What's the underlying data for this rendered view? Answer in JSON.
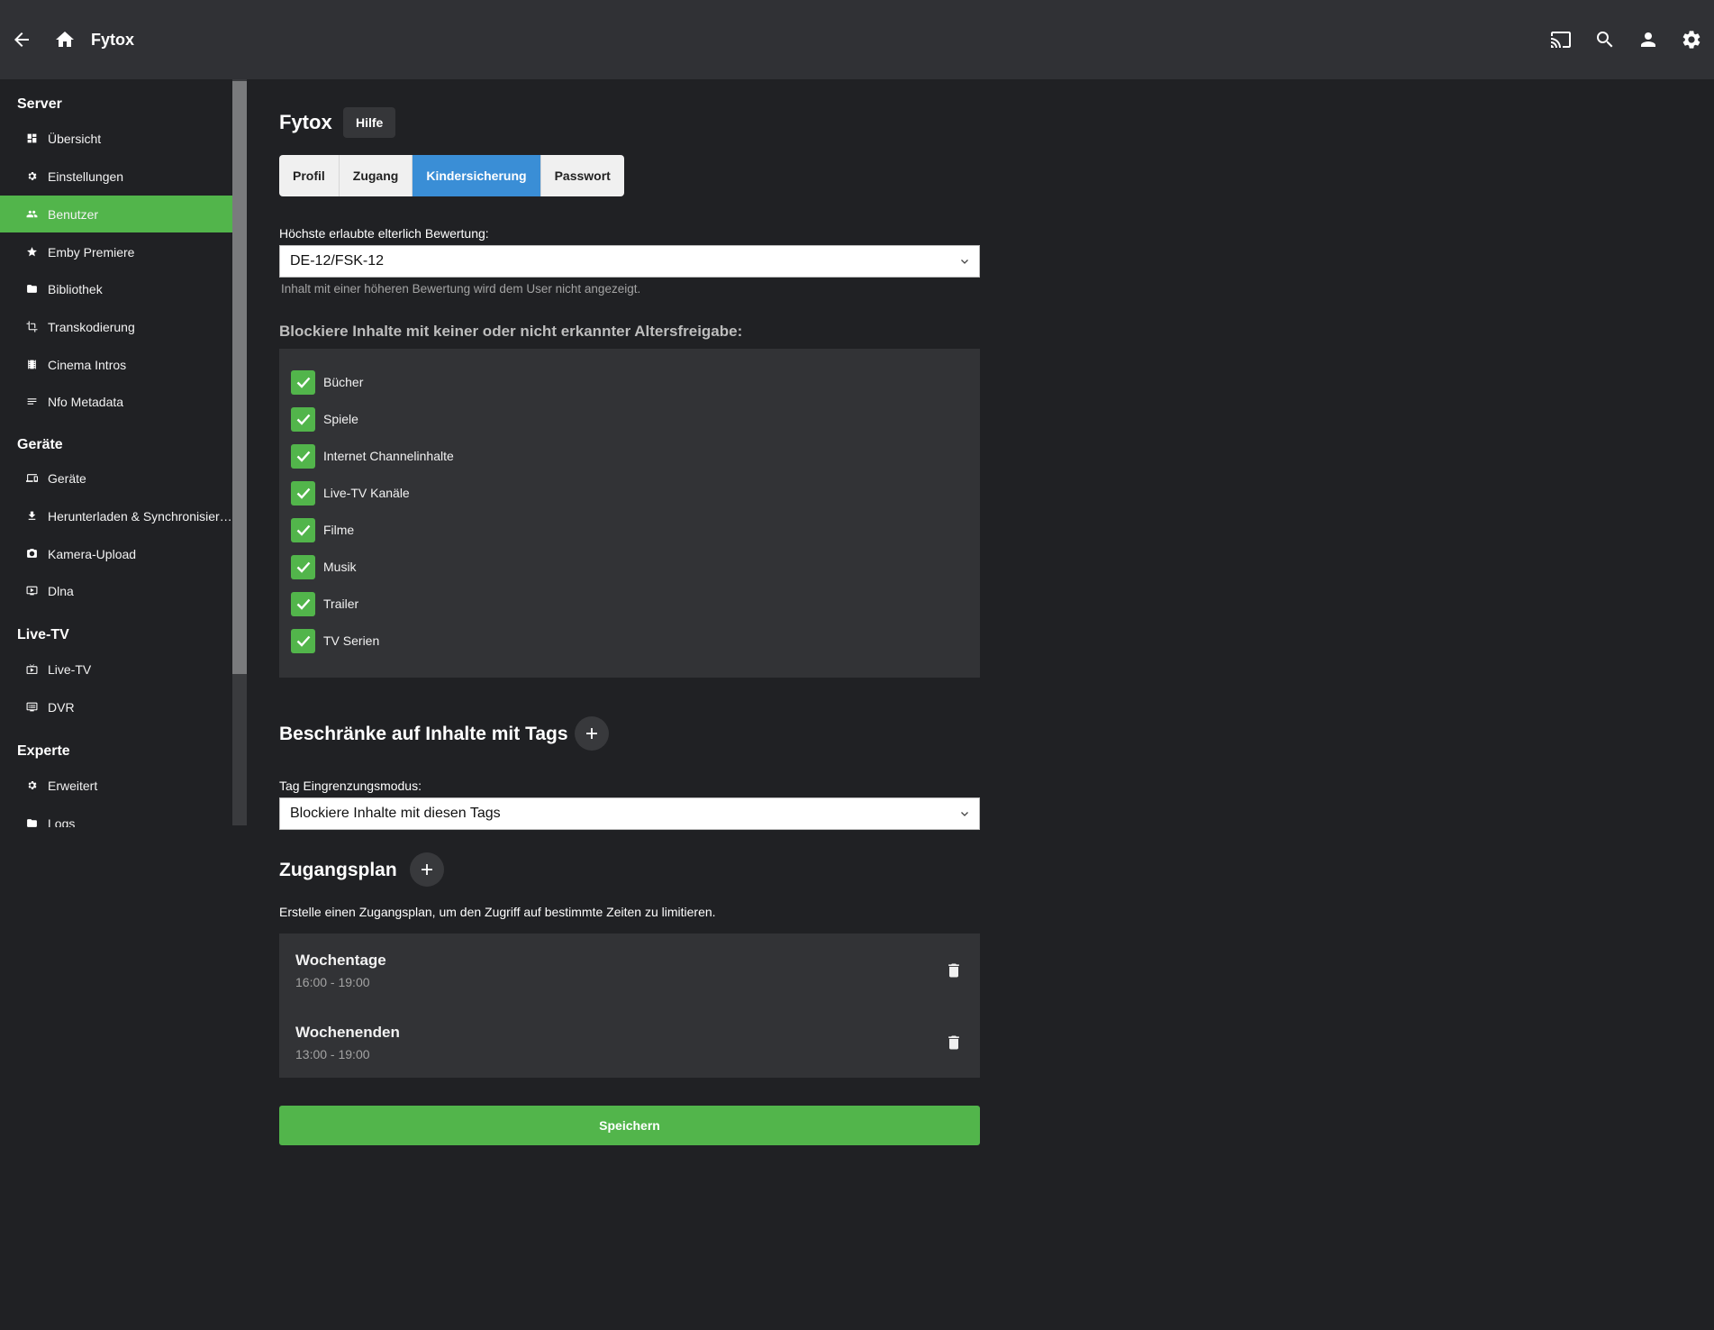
{
  "topbar": {
    "title": "Fytox",
    "icons": [
      "arrow-back-icon",
      "home-icon",
      "cast-icon",
      "search-icon",
      "user-icon",
      "settings-icon"
    ]
  },
  "sidebar": {
    "sections": [
      {
        "title": "Server",
        "items": [
          {
            "label": "Übersicht",
            "icon": "dashboard-icon"
          },
          {
            "label": "Einstellungen",
            "icon": "gear-icon"
          },
          {
            "label": "Benutzer",
            "icon": "people-icon",
            "active": true
          },
          {
            "label": "Emby Premiere",
            "icon": "star-icon"
          },
          {
            "label": "Bibliothek",
            "icon": "folder-icon"
          },
          {
            "label": "Transkodierung",
            "icon": "transcode-icon"
          },
          {
            "label": "Cinema Intros",
            "icon": "film-icon"
          },
          {
            "label": "Nfo Metadata",
            "icon": "notes-icon"
          }
        ]
      },
      {
        "title": "Geräte",
        "items": [
          {
            "label": "Geräte",
            "icon": "devices-icon"
          },
          {
            "label": "Herunterladen & Synchronisieren",
            "icon": "download-icon"
          },
          {
            "label": "Kamera-Upload",
            "icon": "camera-icon"
          },
          {
            "label": "Dlna",
            "icon": "dlna-icon"
          }
        ]
      },
      {
        "title": "Live-TV",
        "items": [
          {
            "label": "Live-TV",
            "icon": "live-tv-icon"
          },
          {
            "label": "DVR",
            "icon": "dvr-icon"
          }
        ]
      },
      {
        "title": "Experte",
        "items": [
          {
            "label": "Erweitert",
            "icon": "gear-icon"
          },
          {
            "label": "Logs",
            "icon": "folder-icon"
          }
        ]
      }
    ]
  },
  "page": {
    "title": "Fytox",
    "help_label": "Hilfe",
    "tabs": [
      {
        "label": "Profil"
      },
      {
        "label": "Zugang"
      },
      {
        "label": "Kindersicherung",
        "active": true
      },
      {
        "label": "Passwort"
      }
    ]
  },
  "rating": {
    "label": "Höchste erlaubte elterlich Bewertung:",
    "value": "DE-12/FSK-12",
    "description": "Inhalt mit einer höheren Bewertung wird dem User nicht angezeigt."
  },
  "block_unrated": {
    "heading": "Blockiere Inhalte mit keiner oder nicht erkannter Altersfreigabe:",
    "items": [
      {
        "label": "Bücher",
        "checked": true
      },
      {
        "label": "Spiele",
        "checked": true
      },
      {
        "label": "Internet Channelinhalte",
        "checked": true
      },
      {
        "label": "Live-TV Kanäle",
        "checked": true
      },
      {
        "label": "Filme",
        "checked": true
      },
      {
        "label": "Musik",
        "checked": true
      },
      {
        "label": "Trailer",
        "checked": true
      },
      {
        "label": "TV Serien",
        "checked": true
      }
    ]
  },
  "tags": {
    "heading": "Beschränke auf Inhalte mit Tags",
    "mode_label": "Tag Eingrenzungsmodus:",
    "mode_value": "Blockiere Inhalte mit diesen Tags"
  },
  "schedule": {
    "heading": "Zugangsplan",
    "description": "Erstelle einen Zugangsplan, um den Zugriff auf bestimmte Zeiten zu limitieren.",
    "items": [
      {
        "title": "Wochentage",
        "time": "16:00 - 19:00"
      },
      {
        "title": "Wochenenden",
        "time": "13:00 - 19:00"
      }
    ]
  },
  "save_label": "Speichern",
  "colors": {
    "accent_green": "#52b54b",
    "tab_active_blue": "#3a8ed6",
    "background": "#202124",
    "topbar": "#303135",
    "panel": "#323336"
  }
}
